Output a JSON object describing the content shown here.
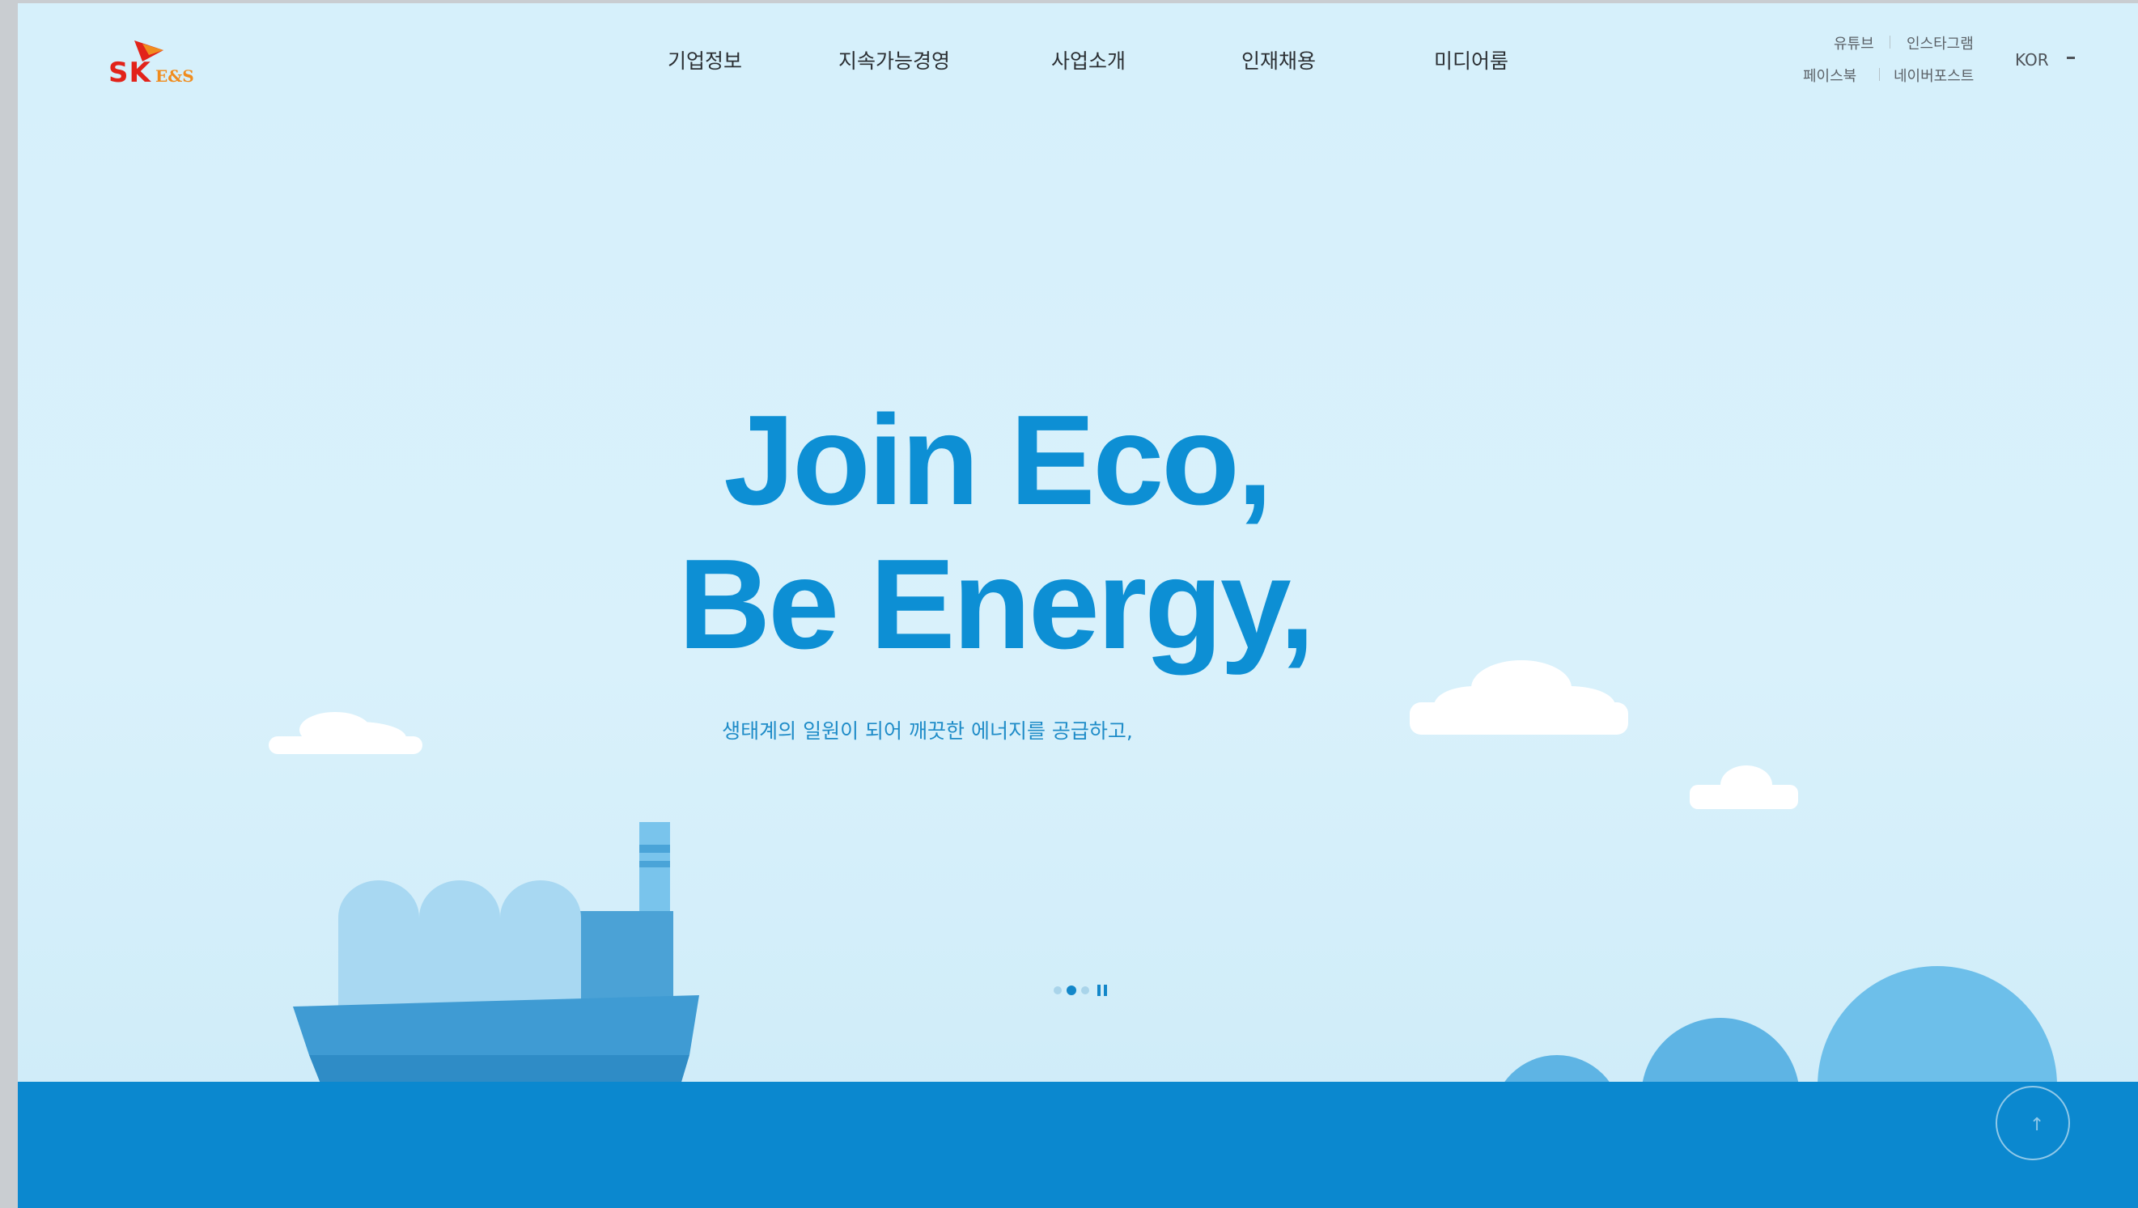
{
  "header": {
    "logo_text": "SK E&S",
    "nav": [
      "기업정보",
      "지속가능경영",
      "사업소개",
      "인재채용",
      "미디어룸"
    ],
    "social": {
      "youtube": "유튜브",
      "instagram": "인스타그램",
      "facebook": "페이스북",
      "naver_post": "네이버포스트"
    },
    "language": "KOR"
  },
  "hero": {
    "title_line1": "Join Eco,",
    "title_line2": "Be Energy,",
    "subtitle": "생태계의 일원이 되어 깨끗한 에너지를 공급하고,"
  },
  "carousel": {
    "slide_count": 3,
    "active_slide": 2
  },
  "colors": {
    "accent": "#0d8fd4",
    "sea": "#0b88cf",
    "sky": "#d6f0fb",
    "logo_red": "#e2231a",
    "logo_orange": "#f08c1e"
  }
}
